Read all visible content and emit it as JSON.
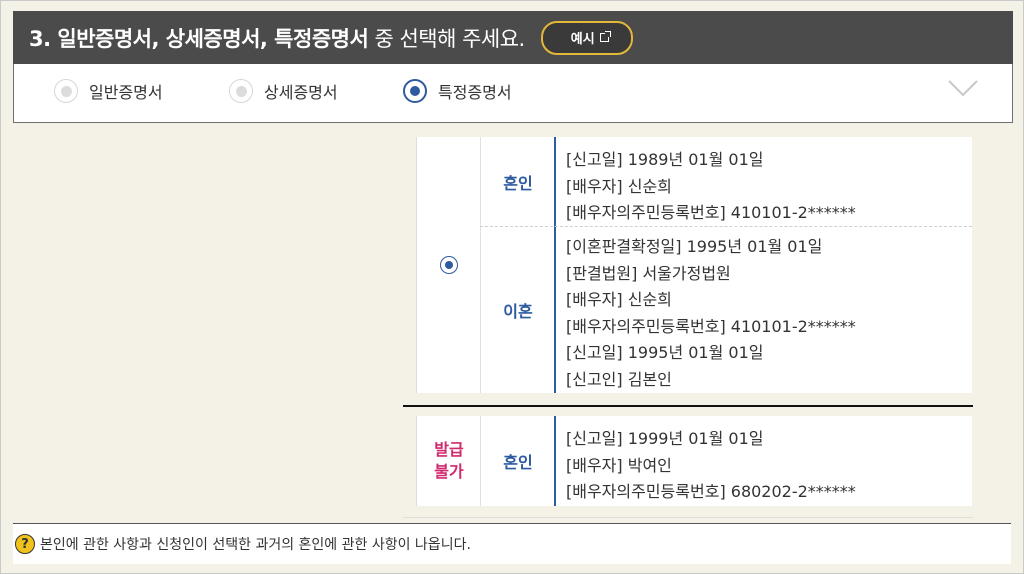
{
  "header": {
    "title_bold": "3. 일반증명서, 상세증명서, 특정증명서",
    "title_rest": " 중 선택해 주세요.",
    "example_button": "예시"
  },
  "options": [
    {
      "label": "일반증명서",
      "selected": false
    },
    {
      "label": "상세증명서",
      "selected": false
    },
    {
      "label": "특정증명서",
      "selected": true
    }
  ],
  "records": {
    "group1": {
      "marriage": {
        "kind": "혼인",
        "lines": [
          "[신고일] 1989년 01월 01일",
          "[배우자] 신순희",
          "[배우자의주민등록번호] 410101-2******"
        ]
      },
      "divorce": {
        "kind": "이혼",
        "lines": [
          "[이혼판결확정일] 1995년 01월 01일",
          "[판결법원] 서울가정법원",
          "[배우자] 신순희",
          "[배우자의주민등록번호] 410101-2******",
          "[신고일] 1995년 01월 01일",
          "[신고인] 김본인"
        ]
      }
    },
    "group2": {
      "status_line1": "발급",
      "status_line2": "불가",
      "kind": "혼인",
      "lines": [
        "[신고일] 1999년 01월 01일",
        "[배우자] 박여인",
        "[배우자의주민등록번호] 680202-2******"
      ]
    }
  },
  "note": "본인에 관한 사항과 신청인이 선택한 과거의 혼인에 관한 사항이 나옵니다.",
  "colors": {
    "header_bg": "#4b4b4b",
    "accent": "#2e5aa0",
    "unavailable": "#d1296d",
    "button_border": "#e3b73a"
  }
}
